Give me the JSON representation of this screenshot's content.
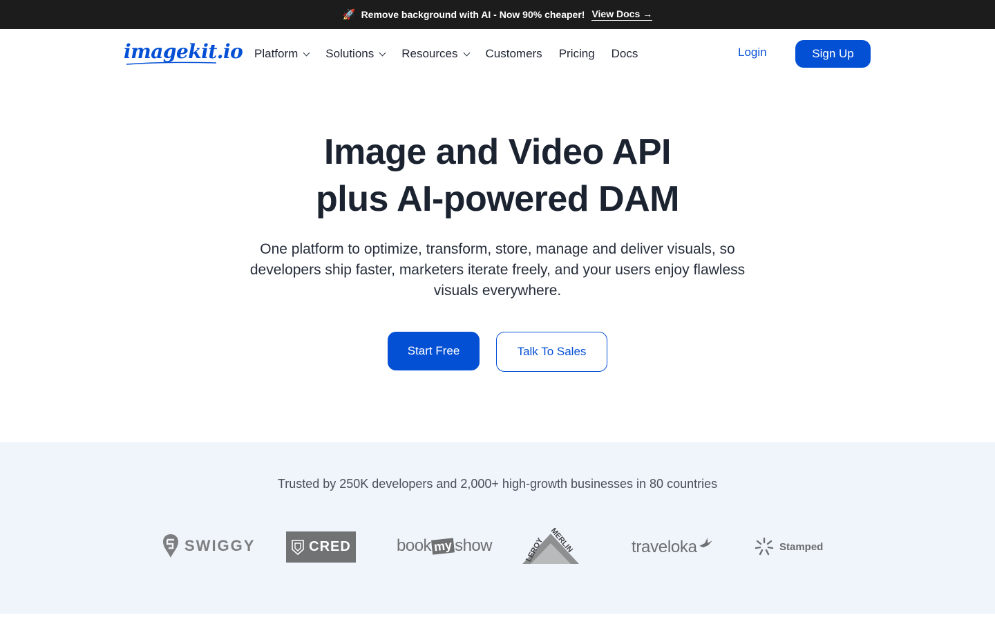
{
  "announcement": {
    "icon": "rocket-icon",
    "message": "Remove background with AI - Now 90% cheaper!",
    "link_label": "View Docs →"
  },
  "header": {
    "logo_text": "imagekit.io",
    "nav": [
      {
        "label": "Platform",
        "has_dropdown": true
      },
      {
        "label": "Solutions",
        "has_dropdown": true
      },
      {
        "label": "Resources",
        "has_dropdown": true
      },
      {
        "label": "Customers",
        "has_dropdown": false
      },
      {
        "label": "Pricing",
        "has_dropdown": false
      },
      {
        "label": "Docs",
        "has_dropdown": false
      }
    ],
    "login_label": "Login",
    "signup_label": "Sign Up"
  },
  "hero": {
    "title_line1": "Image and Video API",
    "title_line2": "plus AI-powered DAM",
    "subtitle": "One platform to optimize, transform, store, manage and deliver visuals, so developers ship faster, marketers iterate freely, and your users enjoy flawless visuals everywhere.",
    "primary_cta": "Start Free",
    "secondary_cta": "Talk To Sales"
  },
  "trusted": {
    "text": "Trusted by 250K developers and 2,000+ high-growth businesses in 80 countries",
    "logos": [
      {
        "name": "SWIGGY"
      },
      {
        "name": "CRED"
      },
      {
        "name_a": "book",
        "name_b": "my",
        "name_c": "show"
      },
      {
        "name_a": "LEROY",
        "name_b": "MERLIN"
      },
      {
        "name": "traveloka"
      },
      {
        "name": "Stamped"
      }
    ]
  },
  "colors": {
    "brand_blue": "#0450d5",
    "announcement_bg": "#1c1c1c",
    "trusted_bg": "#f0f5fc",
    "logo_gray": "#7a7b7d"
  }
}
